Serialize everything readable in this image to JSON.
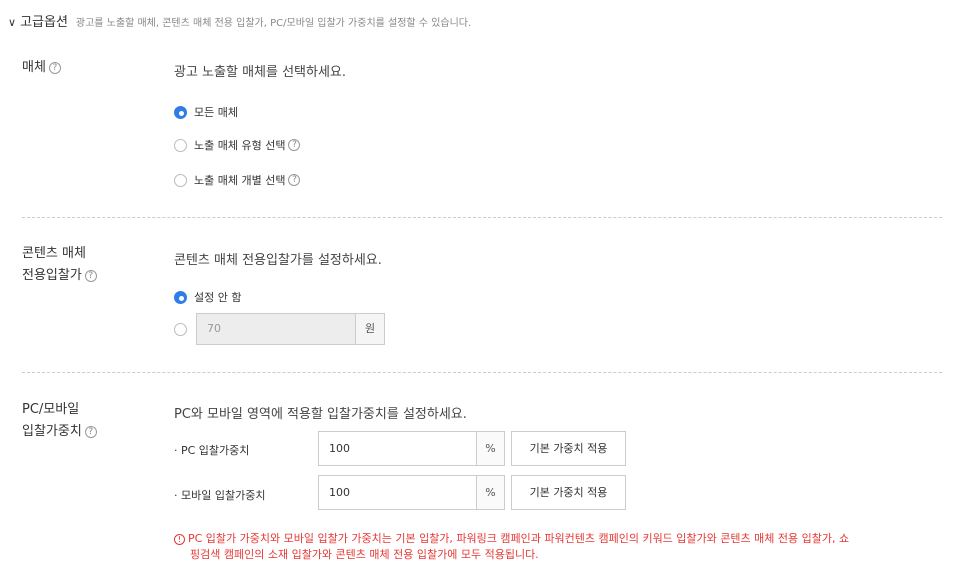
{
  "advanced": {
    "title": "고급옵션",
    "description": "광고를 노출할 매체, 콘텐츠 매체 전용 입찰가, PC/모바일 입찰가 가중치를 설정할 수 있습니다."
  },
  "media": {
    "label": "매체",
    "prompt": "광고 노출할 매체를 선택하세요.",
    "options": [
      {
        "label": "모든 매체",
        "selected": true
      },
      {
        "label": "노출 매체 유형 선택",
        "selected": false
      },
      {
        "label": "노출 매체 개별 선택",
        "selected": false
      }
    ]
  },
  "content_bid": {
    "label_line1": "콘텐츠 매체",
    "label_line2": "전용입찰가",
    "prompt": "콘텐츠 매체 전용입찰가를 설정하세요.",
    "option_none": "설정 안 함",
    "value": "70",
    "unit": "원"
  },
  "weight": {
    "label_line1": "PC/모바일",
    "label_line2": "입찰가중치",
    "prompt": "PC와 모바일 영역에 적용할 입찰가중치를 설정하세요.",
    "pc_label": "· PC 입찰가중치",
    "pc_value": "100",
    "mobile_label": "· 모바일 입찰가중치",
    "mobile_value": "100",
    "unit": "%",
    "default_button": "기본 가중치 적용",
    "notice_line1": "PC 입찰가 가중치와 모바일 입찰가 가중치는 기본 입찰가, 파워링크 캠페인과 파워컨텐츠 캠페인의 키워드 입찰가와 콘텐츠 매체 전용 입찰가, 쇼",
    "notice_line2": "핑검색 캠페인의 소재 입찰가와 콘텐츠 매체 전용 입찰가에 모두 적용됩니다."
  },
  "icons": {
    "help": "?",
    "warn": "!",
    "chevron": "∨"
  },
  "colors": {
    "accent": "#2f7ee8",
    "warning": "#e53935"
  }
}
